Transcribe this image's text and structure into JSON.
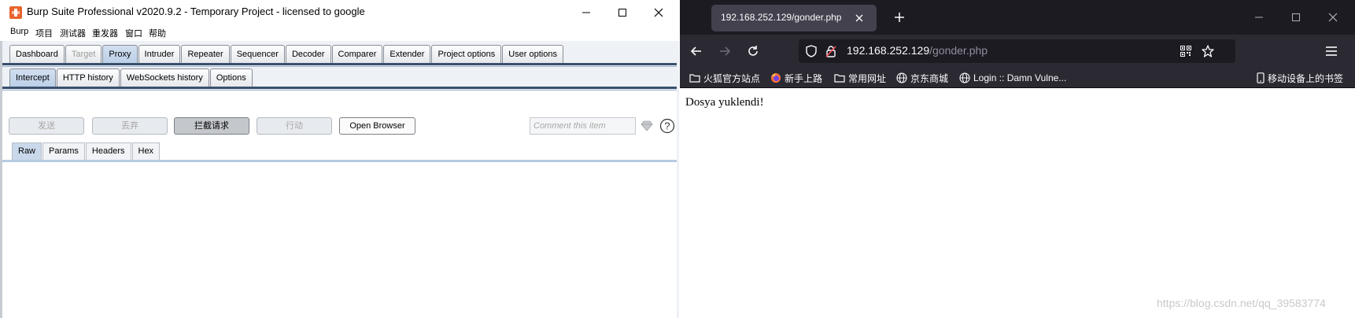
{
  "burp": {
    "title": "Burp Suite Professional v2020.9.2 - Temporary Project - licensed to google",
    "menu": [
      "Burp",
      "项目",
      "测试器",
      "重发器",
      "窗口",
      "帮助"
    ],
    "main_tabs": [
      "Dashboard",
      "Target",
      "Proxy",
      "Intruder",
      "Repeater",
      "Sequencer",
      "Decoder",
      "Comparer",
      "Extender",
      "Project options",
      "User options"
    ],
    "active_main_tab": "Proxy",
    "proxy_tabs": [
      "Intercept",
      "HTTP history",
      "WebSockets history",
      "Options"
    ],
    "active_proxy_tab": "Intercept",
    "buttons": {
      "forward": "发送",
      "drop": "丢弃",
      "intercept": "拦截请求",
      "action": "行动",
      "open_browser": "Open Browser"
    },
    "comment_placeholder": "Comment this item",
    "editor_tabs": [
      "Raw",
      "Params",
      "Headers",
      "Hex"
    ],
    "active_editor_tab": "Raw"
  },
  "firefox": {
    "tab_title": "192.168.252.129/gonder.php",
    "url_host": "192.168.252.129",
    "url_path": "/gonder.php",
    "bookmarks": [
      "火狐官方站点",
      "新手上路",
      "常用网址",
      "京东商城",
      "Login :: Damn Vulne...",
      "移动设备上的书签"
    ],
    "page_text": "Dosya yuklendi!"
  },
  "watermark": "https://blog.csdn.net/qq_39583774",
  "icons": {
    "burp_logo": "burp-logo-icon",
    "firefox_logo": "firefox-icon",
    "folder": "folder-icon",
    "globe": "globe-icon",
    "mobile": "mobile-icon"
  },
  "colors": {
    "burp_accent": "#39506d",
    "firefox_toolbar": "#2b2a33",
    "firefox_tabstrip": "#1c1b22",
    "firefox_active_tab": "#42414d"
  }
}
